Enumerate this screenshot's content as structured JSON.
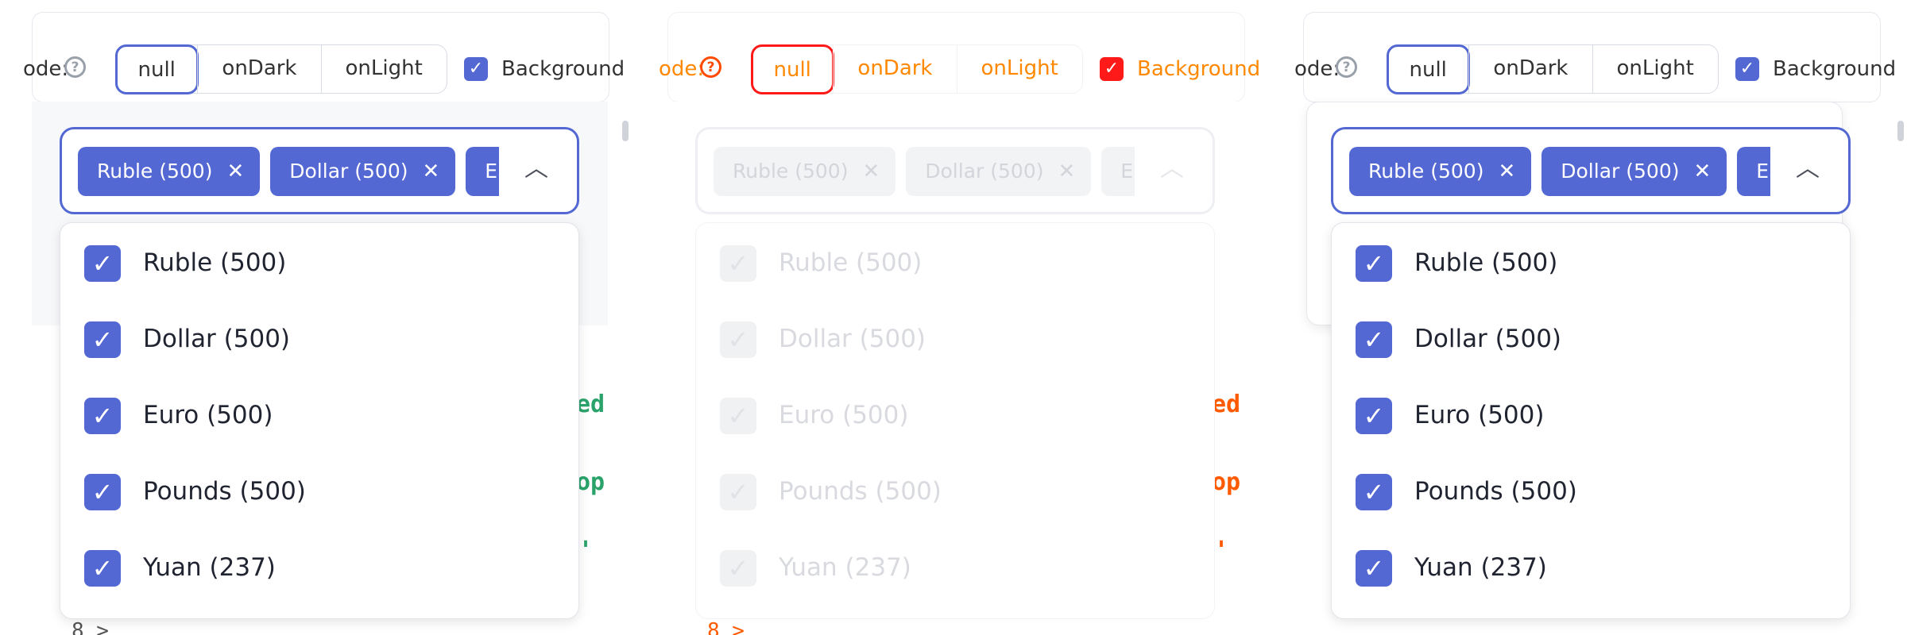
{
  "toolbar": {
    "mode_label": "ode:",
    "help_icon": "?",
    "modes": [
      "null",
      "onDark",
      "onLight"
    ],
    "active_mode": "null",
    "background_label": "Background",
    "background_checked": true
  },
  "select": {
    "chips": [
      {
        "label": "Ruble (500)"
      },
      {
        "label": "Dollar (500)"
      },
      {
        "label": "Euro"
      }
    ],
    "remove_icon": "✕",
    "caret_icon": "chevron-up-icon"
  },
  "options": [
    {
      "label": "Ruble (500)",
      "checked": true
    },
    {
      "label": "Dollar (500)",
      "checked": true
    },
    {
      "label": "Euro (500)",
      "checked": true
    },
    {
      "label": "Pounds (500)",
      "checked": true
    },
    {
      "label": "Yuan (237)",
      "checked": true
    }
  ],
  "background_fragments": {
    "line1": "ed",
    "line2": "op",
    "line3": "'",
    "line4": "8  >"
  },
  "colors": {
    "accent": "#5468d4",
    "diff_orange": "#ff8800",
    "diff_red": "#ff1a1a",
    "code_green": "#2aa36b"
  }
}
